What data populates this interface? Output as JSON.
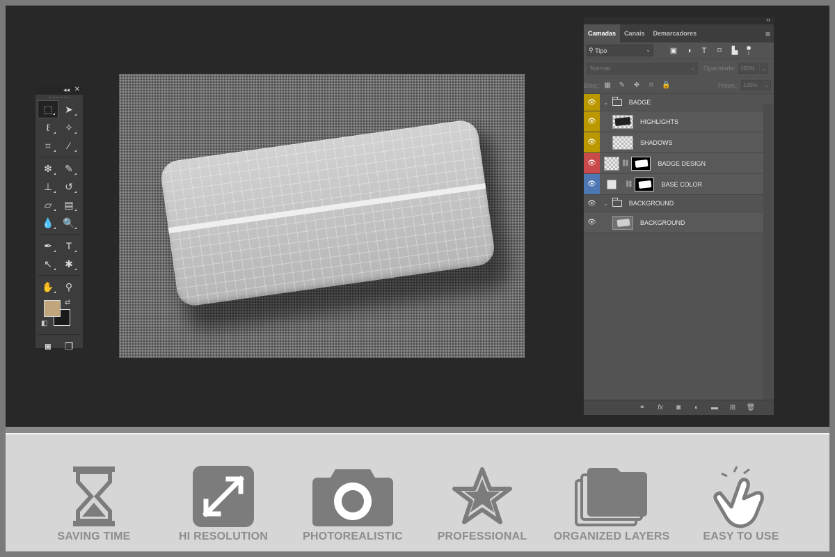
{
  "tools_panel": {
    "collapse_label": "◂◂",
    "close_label": "✕",
    "colors": {
      "foreground": "#c1a57c",
      "background": "#1a1a1a"
    }
  },
  "layers_panel": {
    "collapse_label": "››",
    "tabs": [
      {
        "label": "Camadas",
        "active": true
      },
      {
        "label": "Canais",
        "active": false
      },
      {
        "label": "Demarcadores",
        "active": false
      }
    ],
    "filter": {
      "selected": "Tipo"
    },
    "blend": {
      "selected": "Normal"
    },
    "opacity": {
      "label": "Opacidade:",
      "value": "100%"
    },
    "lock": {
      "label": "Bloq.:"
    },
    "fill": {
      "label": "Preen.:",
      "value": "100%"
    },
    "layers": [
      {
        "name": "BADGE",
        "type": "group",
        "eye_color": "#bb9800"
      },
      {
        "name": "HIGHLIGHTS",
        "type": "layer",
        "eye_color": "#bb9800"
      },
      {
        "name": "SHADOWS",
        "type": "layer",
        "eye_color": "#bb9800"
      },
      {
        "name": "BADGE DESIGN",
        "type": "smart-layer",
        "eye_color": "#c94a4a"
      },
      {
        "name": "BASE COLOR",
        "type": "fill-layer",
        "eye_color": "#4e78b3"
      },
      {
        "name": "BACKGROUND",
        "type": "group",
        "eye_color": ""
      },
      {
        "name": "BACKGROUND",
        "type": "layer",
        "eye_color": ""
      }
    ]
  },
  "features": [
    {
      "label": "SAVING TIME",
      "icon": "hourglass-icon"
    },
    {
      "label": "HI RESOLUTION",
      "icon": "expand-icon"
    },
    {
      "label": "PHOTOREALISTIC",
      "icon": "camera-icon"
    },
    {
      "label": "PROFESSIONAL",
      "icon": "star-icon"
    },
    {
      "label": "ORGANIZED LAYERS",
      "icon": "folder-stack-icon"
    },
    {
      "label": "EASY TO USE",
      "icon": "tap-hand-icon"
    }
  ],
  "colors": {
    "icon_gray": "#7c7c7c",
    "label_gray": "#8d8d8d",
    "band_bg": "#d6d6d6",
    "workspace_bg": "#282828"
  }
}
